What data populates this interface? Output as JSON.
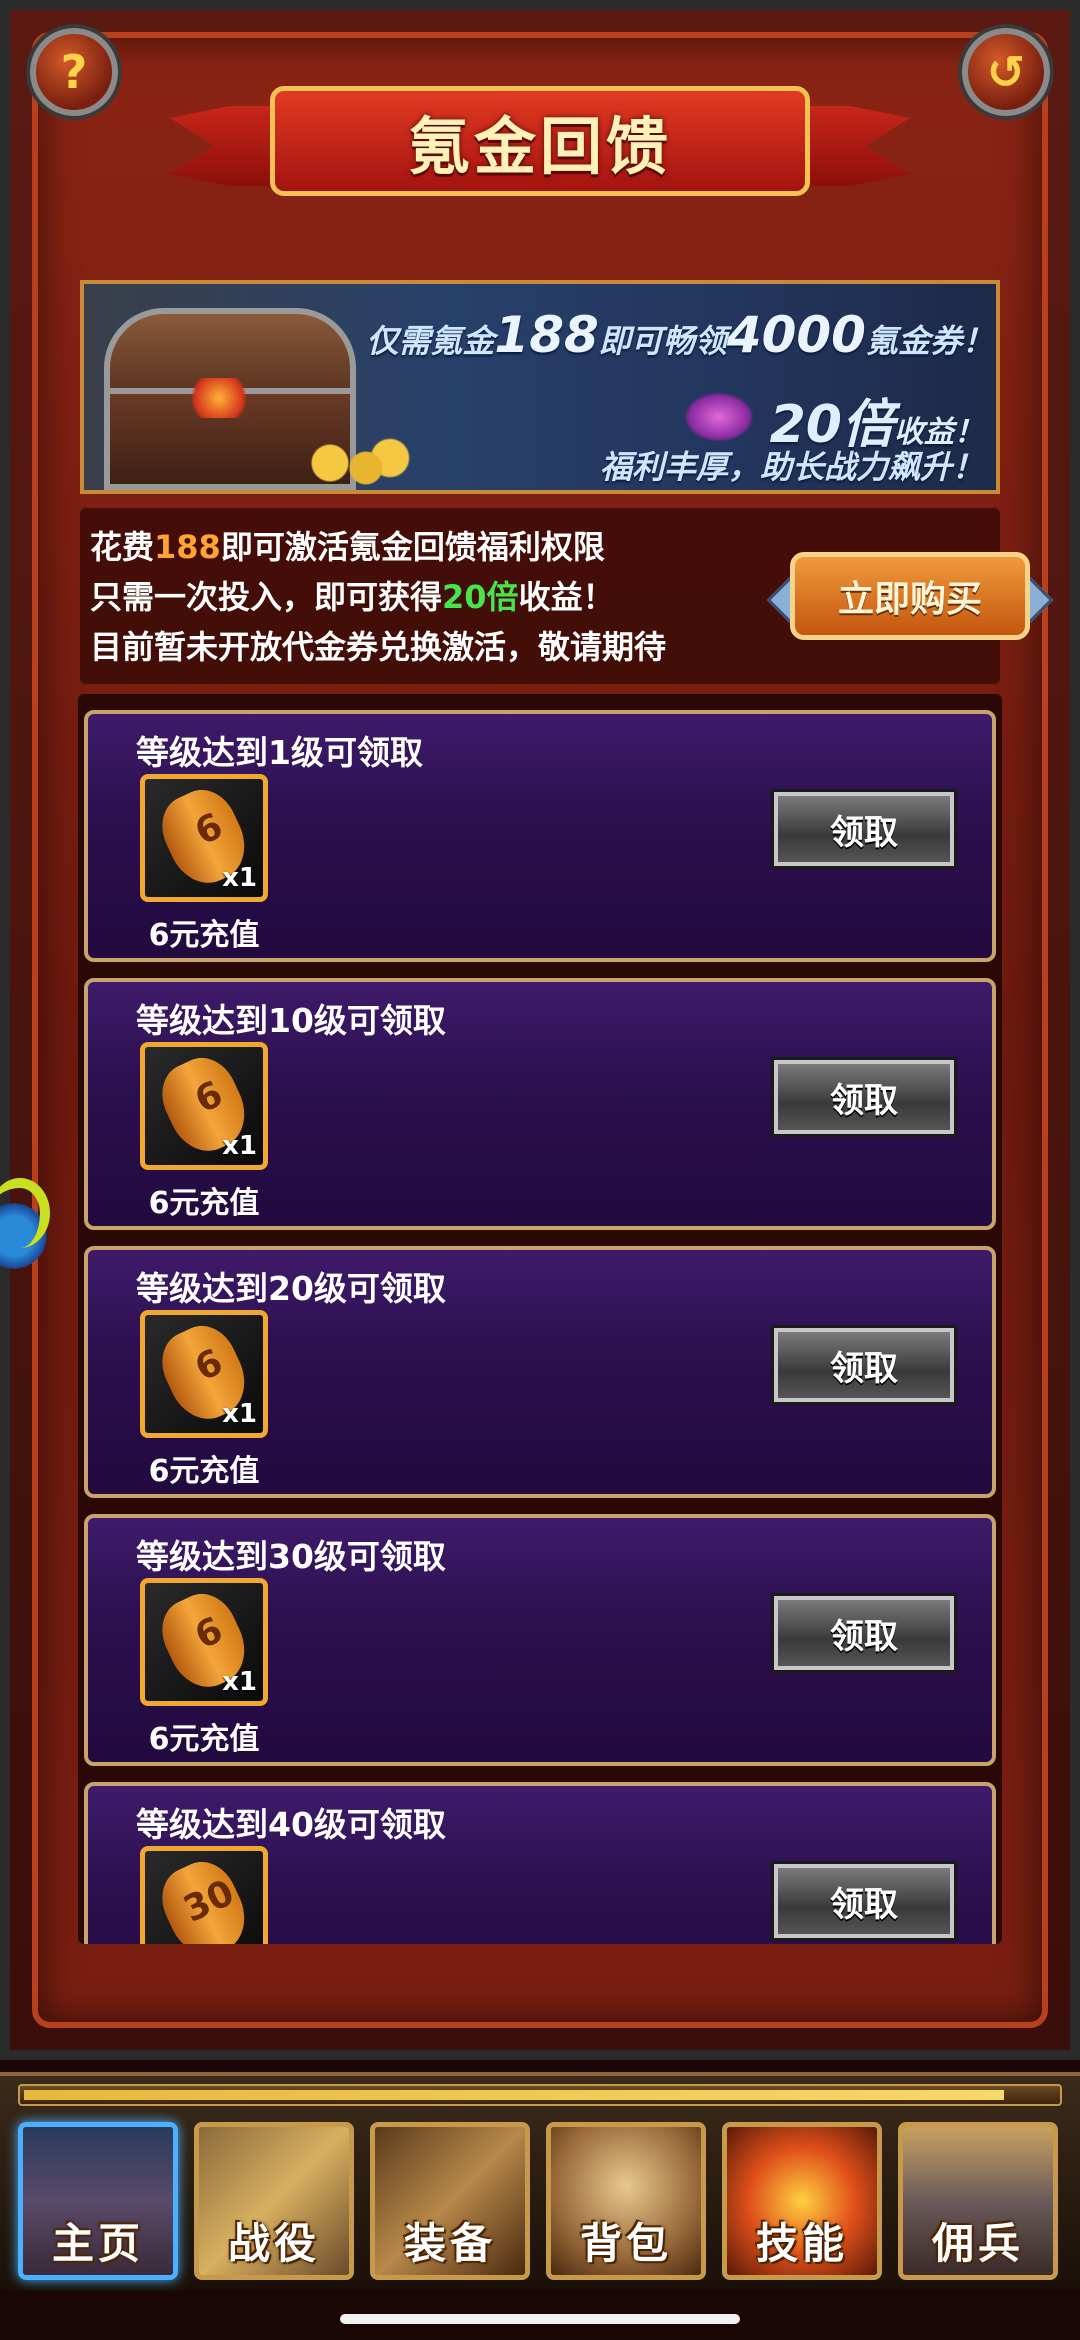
{
  "header": {
    "title": "氪金回馈",
    "help_icon": "?",
    "back_icon": "↺"
  },
  "promo": {
    "line1_a": "仅需氪金",
    "line1_b": "188",
    "line1_c": "即可畅领",
    "line1_d": "4000",
    "line1_e": "氪金券！",
    "line2_a": "20倍",
    "line2_b": "收益！",
    "line3": "福利丰厚，助长战力飙升！"
  },
  "info": {
    "line1_pre": "花费",
    "line1_amount": "188",
    "line1_post": "即可激活氪金回馈福利权限",
    "line2_pre": "只需一次投入，即可获得",
    "line2_mult": "20倍",
    "line2_post": "收益！",
    "line3": "目前暂未开放代金券兑换激活，敬请期待",
    "buy_label": "立即购买"
  },
  "rewards": [
    {
      "title": "等级达到1级可领取",
      "ring": "6",
      "qty": "x1",
      "name": "6元充值",
      "button": "领取"
    },
    {
      "title": "等级达到10级可领取",
      "ring": "6",
      "qty": "x1",
      "name": "6元充值",
      "button": "领取"
    },
    {
      "title": "等级达到20级可领取",
      "ring": "6",
      "qty": "x1",
      "name": "6元充值",
      "button": "领取"
    },
    {
      "title": "等级达到30级可领取",
      "ring": "6",
      "qty": "x1",
      "name": "6元充值",
      "button": "领取"
    },
    {
      "title": "等级达到40级可领取",
      "ring": "30",
      "qty": "",
      "name": "",
      "button": "领取"
    }
  ],
  "navbar": {
    "progress": 0.95,
    "items": [
      {
        "label": "主页",
        "active": true
      },
      {
        "label": "战役",
        "active": false
      },
      {
        "label": "装备",
        "active": false
      },
      {
        "label": "背包",
        "active": false
      },
      {
        "label": "技能",
        "active": false
      },
      {
        "label": "佣兵",
        "active": false
      }
    ]
  },
  "colors": {
    "accent_orange": "#ffa432",
    "accent_green": "#46e64a",
    "active_tab": "#4ab0ff"
  }
}
